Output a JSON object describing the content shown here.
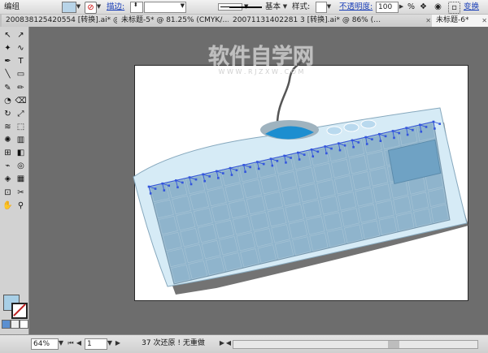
{
  "control_bar": {
    "mode_label": "编组",
    "stroke_label": "描边:",
    "stroke_value": "",
    "stroke_style": "基本",
    "style_label": "样式:",
    "opacity_label": "不透明度:",
    "opacity_value": "100",
    "opacity_unit": "%",
    "transform_label": "变换",
    "fill_color": "#b8d4e8"
  },
  "tabs": [
    {
      "label": "200838125420554  [转换].ai* @ 74% (…",
      "active": false
    },
    {
      "label": "未标题-5* @ 81.25% (CMYK/…",
      "active": false
    },
    {
      "label": "20071131402281 3  [转换].ai* @ 86% (…",
      "active": false
    },
    {
      "label": "未标题-6*",
      "active": true
    }
  ],
  "toolbox": {
    "tools": [
      {
        "name": "selection-tool",
        "glyph": "↖"
      },
      {
        "name": "direct-selection-tool",
        "glyph": "↗"
      },
      {
        "name": "magic-wand-tool",
        "glyph": "✦"
      },
      {
        "name": "lasso-tool",
        "glyph": "∿"
      },
      {
        "name": "pen-tool",
        "glyph": "✒"
      },
      {
        "name": "type-tool",
        "glyph": "T"
      },
      {
        "name": "line-tool",
        "glyph": "╲"
      },
      {
        "name": "rectangle-tool",
        "glyph": "▭"
      },
      {
        "name": "paintbrush-tool",
        "glyph": "✎"
      },
      {
        "name": "pencil-tool",
        "glyph": "✏"
      },
      {
        "name": "blob-brush-tool",
        "glyph": "◔"
      },
      {
        "name": "eraser-tool",
        "glyph": "⌫"
      },
      {
        "name": "rotate-tool",
        "glyph": "↻"
      },
      {
        "name": "scale-tool",
        "glyph": "⤢"
      },
      {
        "name": "warp-tool",
        "glyph": "≋"
      },
      {
        "name": "free-transform-tool",
        "glyph": "⬚"
      },
      {
        "name": "symbol-sprayer-tool",
        "glyph": "✺"
      },
      {
        "name": "column-graph-tool",
        "glyph": "▥"
      },
      {
        "name": "mesh-tool",
        "glyph": "⊞"
      },
      {
        "name": "gradient-tool",
        "glyph": "◧"
      },
      {
        "name": "eyedropper-tool",
        "glyph": "⌁"
      },
      {
        "name": "blend-tool",
        "glyph": "◎"
      },
      {
        "name": "live-paint-bucket-tool",
        "glyph": "◈"
      },
      {
        "name": "live-paint-selection-tool",
        "glyph": "▦"
      },
      {
        "name": "artboard-tool",
        "glyph": "⊡"
      },
      {
        "name": "slice-tool",
        "glyph": "✂"
      },
      {
        "name": "hand-tool",
        "glyph": "✋"
      },
      {
        "name": "zoom-tool",
        "glyph": "⚲"
      }
    ],
    "fill_color": "#a8cfe6",
    "stroke_color": "#c02020"
  },
  "artwork": {
    "watermark_title": "软件自学网",
    "watermark_url": "W W W . R J Z X W . C O M",
    "keyboard_body_color": "#d6ebf6",
    "keys_color": "#8fb4cc",
    "highlight_color": "#6fa2c4",
    "blue_accent": "#1c8ed0",
    "anchor_color": "#3355dd"
  },
  "status_bar": {
    "zoom_value": "64%",
    "page_value": "1",
    "status_text": "37 次还原 ! 无重做"
  }
}
